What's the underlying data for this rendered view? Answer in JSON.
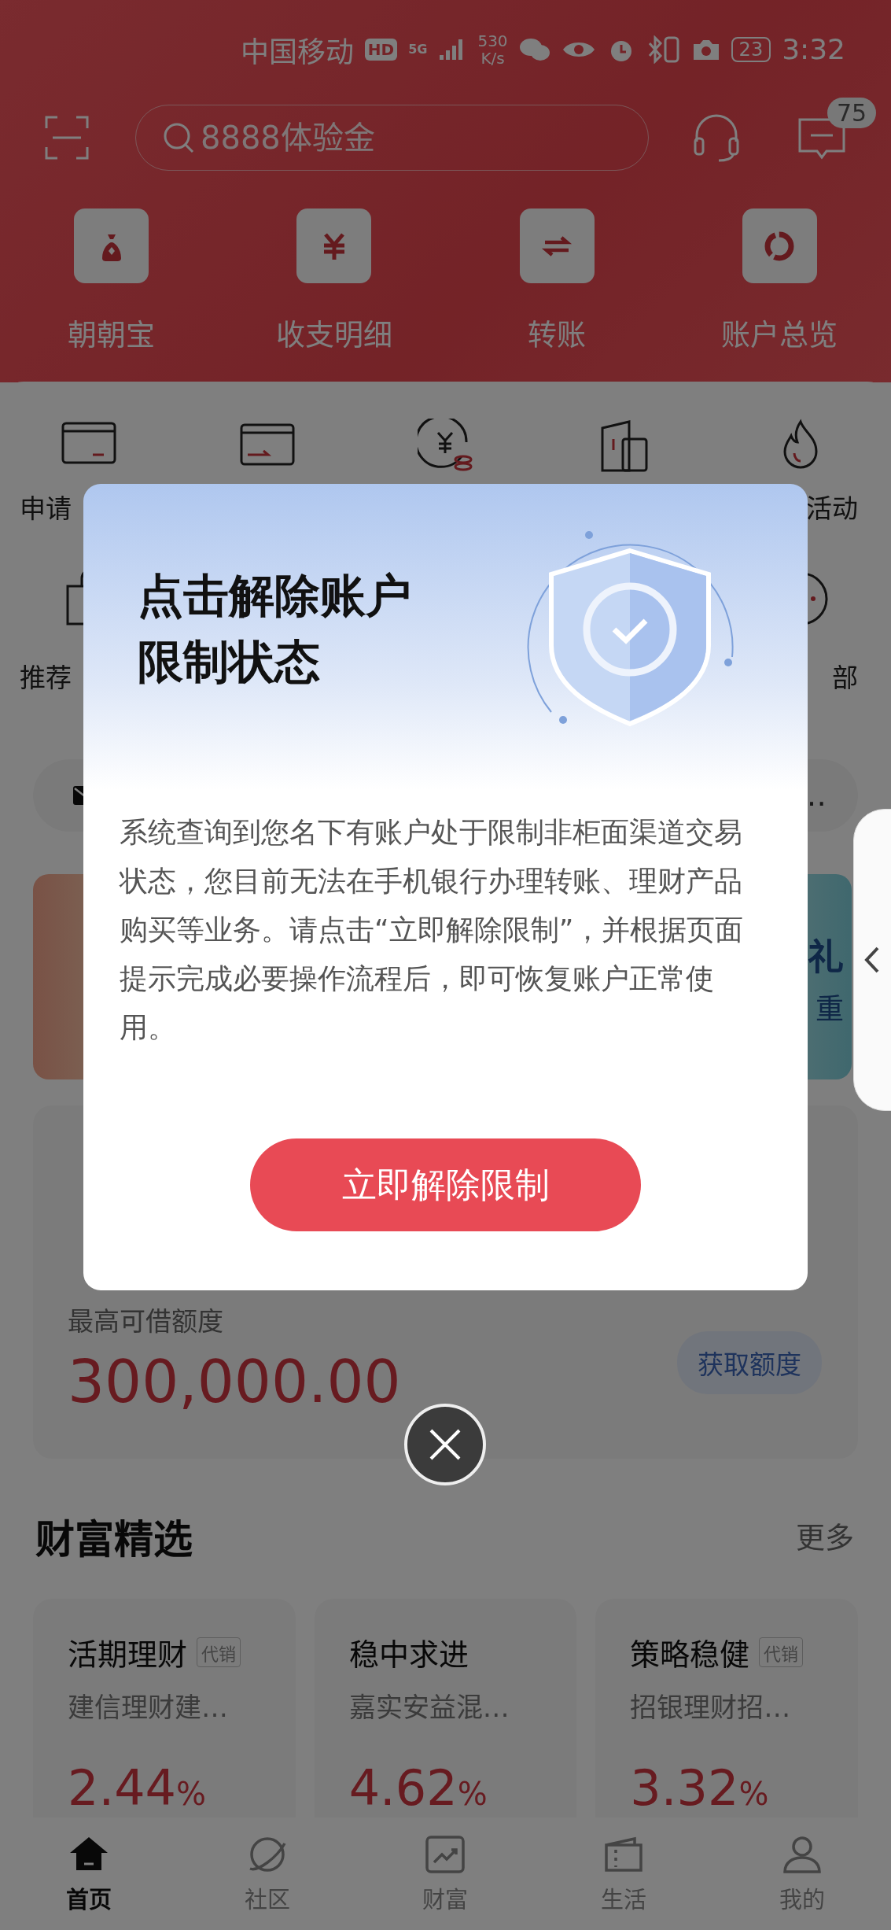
{
  "status_bar": {
    "carrier": "中国移动",
    "hd": "HD",
    "network": "5G",
    "speed": "530",
    "speed_unit": "K/s",
    "battery": "23",
    "time": "3:32"
  },
  "header": {
    "search": {
      "placeholder": "8888体验金"
    },
    "message_badge": "75"
  },
  "quick_actions": [
    {
      "label": "朝朝宝"
    },
    {
      "label": "收支明细"
    },
    {
      "label": "转账"
    },
    {
      "label": "账户总览"
    }
  ],
  "services_row_1": [
    {
      "label": "申请"
    },
    {
      "label": "活动"
    }
  ],
  "services_row_2": [
    {
      "label": "推荐"
    },
    {
      "label": "部"
    }
  ],
  "notice": {
    "text": "…"
  },
  "banner": {
    "title": "礼",
    "subtitle": "重"
  },
  "loan": {
    "label": "最高可借额度",
    "amount": "300,000.00",
    "button": "获取额度"
  },
  "wealth": {
    "title": "财富精选",
    "more": "更多",
    "products": [
      {
        "name": "活期理财",
        "tag": "代销",
        "issuer": "建信理财建…",
        "rate": "2.44",
        "unit": "%"
      },
      {
        "name": "稳中求进",
        "issuer": "嘉实安益混…",
        "rate": "4.62",
        "unit": "%"
      },
      {
        "name": "策略稳健",
        "tag": "代销",
        "issuer": "招银理财招…",
        "rate": "3.32",
        "unit": "%"
      }
    ]
  },
  "bottom_nav": [
    {
      "label": "首页",
      "selected": true
    },
    {
      "label": "社区",
      "selected": false
    },
    {
      "label": "财富",
      "selected": false
    },
    {
      "label": "生活",
      "selected": false
    },
    {
      "label": "我的",
      "selected": false
    }
  ],
  "dialog": {
    "title": "点击解除账户限制状态",
    "body": "系统查询到您名下有账户处于限制非柜面渠道交易状态，您目前无法在手机银行办理转账、理财产品购买等业务。请点击“立即解除限制”，并根据页面提示完成必要操作流程后，即可恢复账户正常使用。",
    "button": "立即解除限制"
  }
}
